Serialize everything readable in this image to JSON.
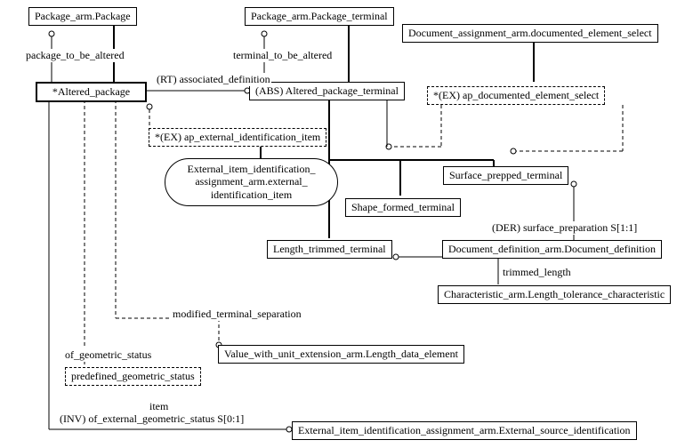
{
  "nodes": {
    "package_arm_package": "Package_arm.Package",
    "package_arm_package_terminal": "Package_arm.Package_terminal",
    "documented_element_select": "Document_assignment_arm.documented_element_select",
    "altered_package": "*Altered_package",
    "abs_altered_package_terminal": "(ABS) Altered_package_terminal",
    "ex_ap_documented_element_select": "*(EX) ap_documented_element_select",
    "ex_ap_external_identification_item": "*(EX) ap_external_identification_item",
    "external_item_identification_item": "External_item_identification_ assignment_arm.external_ identification_item",
    "surface_prepped_terminal": "Surface_prepped_terminal",
    "shape_formed_terminal": "Shape_formed_terminal",
    "length_trimmed_terminal": "Length_trimmed_terminal",
    "document_definition": "Document_definition_arm.Document_definition",
    "length_tolerance_characteristic": "Characteristic_arm.Length_tolerance_characteristic",
    "length_data_element": "Value_with_unit_extension_arm.Length_data_element",
    "predefined_geometric_status": "predefined_geometric_status",
    "external_source_identification": "External_item_identification_assignment_arm.External_source_identification"
  },
  "labels": {
    "package_to_be_altered": "package_to_be_altered",
    "terminal_to_be_altered": "terminal_to_be_altered",
    "rt_associated_definition": "(RT) associated_definition",
    "der_surface_preparation": "(DER) surface_preparation S[1:1]",
    "trimmed_length": "trimmed_length",
    "modified_terminal_separation": "modified_terminal_separation",
    "of_geometric_status": "of_geometric_status",
    "item": "item",
    "inv_of_external_geometric_status": "(INV) of_external_geometric_status S[0:1]"
  }
}
